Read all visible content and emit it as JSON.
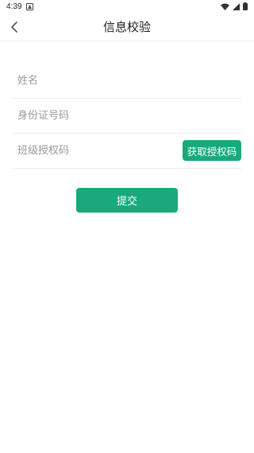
{
  "status_bar": {
    "time": "4:39",
    "notification_icon": "notification-icon",
    "icons": [
      "wifi-icon",
      "signal-icon",
      "battery-icon"
    ]
  },
  "app_bar": {
    "title": "信息校验",
    "back_icon": "back-arrow-icon"
  },
  "form": {
    "name_placeholder": "姓名",
    "id_placeholder": "身份证号码",
    "code_placeholder": "班级授权码",
    "get_code_label": "获取授权码",
    "submit_label": "提交"
  },
  "colors": {
    "accent": "#19a97b",
    "divider": "#eeeeee",
    "placeholder": "#9a9a9a"
  }
}
